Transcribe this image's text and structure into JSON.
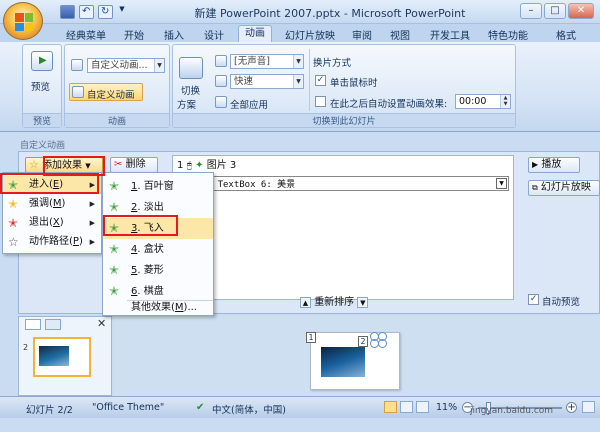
{
  "window": {
    "title": "新建 PowerPoint 2007.pptx - Microsoft PowerPoint",
    "controls": {
      "minimize": "–",
      "restore": "□",
      "close": "✕"
    }
  },
  "tabs": [
    "经典菜单",
    "开始",
    "插入",
    "设计",
    "动画",
    "幻灯片放映",
    "审阅",
    "视图",
    "开发工具",
    "特色功能",
    "格式"
  ],
  "ribbon": {
    "preview_group": {
      "button": "预览",
      "label": "预览"
    },
    "animation_group": {
      "custom_animation_combo": "自定义动画...",
      "custom_animation_button": "自定义动画",
      "label": "动画"
    },
    "transition_group": {
      "switch_scheme_line1": "切换",
      "switch_scheme_line2": "方案",
      "sound_value": "[无声音]",
      "speed_value": "快速",
      "apply_all": "全部应用",
      "advance_title": "换片方式",
      "on_click": "单击鼠标时",
      "auto_after": "在此之后自动设置动画效果:",
      "time_value": "00:00",
      "label": "切换到此幻灯片"
    }
  },
  "pane": {
    "title": "自定义动画",
    "add_effect": "添加效果",
    "delete": "删除",
    "play": "播放",
    "slideshow": "幻灯片放映",
    "list": [
      {
        "index": "1",
        "name": "图片 3"
      },
      {
        "index": "",
        "name": "TextBox 6: 美景"
      }
    ],
    "reorder": "重新排序",
    "autopreview": "自动预览"
  },
  "menu": [
    {
      "label": "进入",
      "key": "E"
    },
    {
      "label": "强调",
      "key": "M"
    },
    {
      "label": "退出",
      "key": "X"
    },
    {
      "label": "动作路径",
      "key": "P"
    }
  ],
  "submenu": [
    {
      "num": "1",
      "label": "百叶窗"
    },
    {
      "num": "2",
      "label": "淡出"
    },
    {
      "num": "3",
      "label": "飞入"
    },
    {
      "num": "4",
      "label": "盒状"
    },
    {
      "num": "5",
      "label": "菱形"
    },
    {
      "num": "6",
      "label": "棋盘"
    }
  ],
  "submenu_more": {
    "label": "其他效果",
    "key": "M"
  },
  "thumb": {
    "number": "2"
  },
  "slide": {
    "marker_1": "1",
    "marker_2": "2"
  },
  "status": {
    "slide": "幻灯片 2/2",
    "theme": "\"Office Theme\"",
    "language": "中文(简体，中国)",
    "zoom": "11%",
    "watermark": "jingyan.baidu.com"
  },
  "colors": {
    "highlight_red": "#e51a1a",
    "menu_hover": "#fde7a8",
    "accent_blue": "#15315a"
  }
}
